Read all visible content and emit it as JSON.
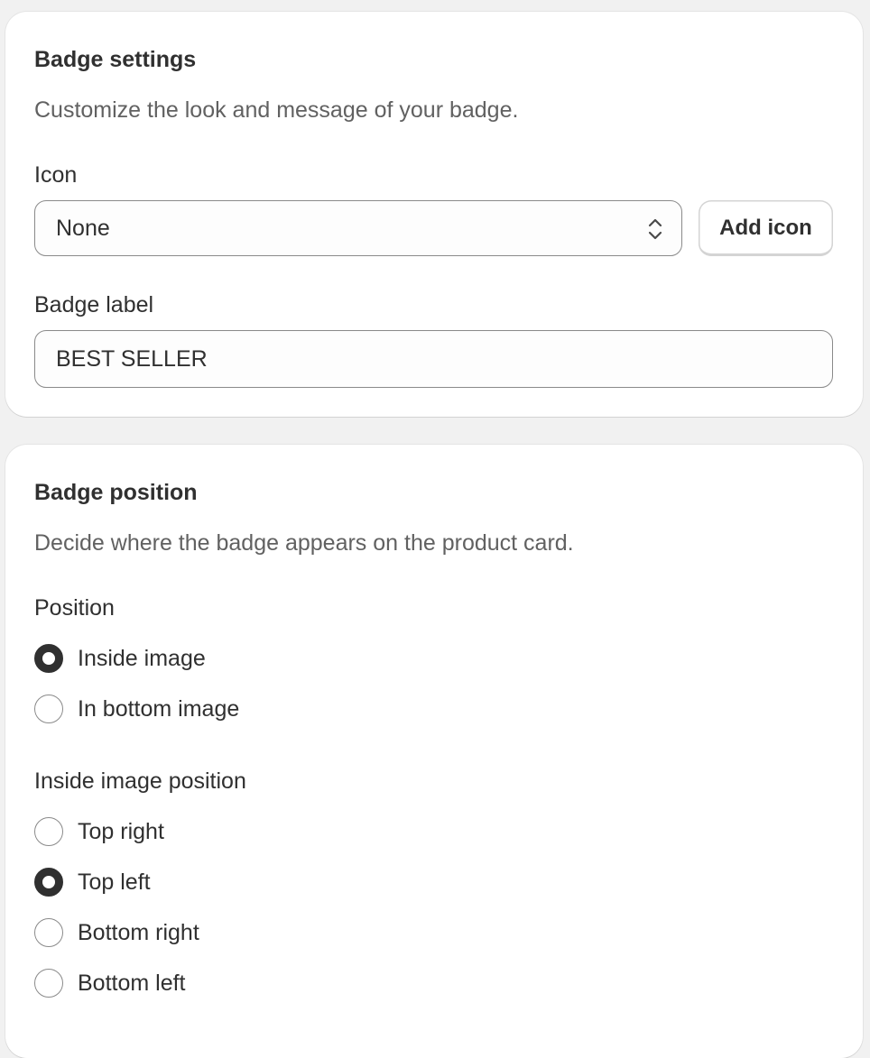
{
  "settings_card": {
    "title": "Badge settings",
    "description": "Customize the look and message of your badge.",
    "icon_label": "Icon",
    "icon_select_value": "None",
    "add_icon_button": "Add icon",
    "badge_label_label": "Badge label",
    "badge_label_value": "BEST SELLER"
  },
  "position_card": {
    "title": "Badge position",
    "description": "Decide where the badge appears on the product card.",
    "position_label": "Position",
    "position_options": [
      {
        "label": "Inside image",
        "selected": true
      },
      {
        "label": "In bottom image",
        "selected": false
      }
    ],
    "inside_position_label": "Inside image position",
    "inside_position_options": [
      {
        "label": "Top right",
        "selected": false
      },
      {
        "label": "Top left",
        "selected": true
      },
      {
        "label": "Bottom right",
        "selected": false
      },
      {
        "label": "Bottom left",
        "selected": false
      }
    ]
  },
  "colors": {
    "page_bg": "#f1f1f1",
    "card_bg": "#ffffff",
    "text": "#303030",
    "muted_text": "#616161",
    "border": "#8a8a8a"
  }
}
